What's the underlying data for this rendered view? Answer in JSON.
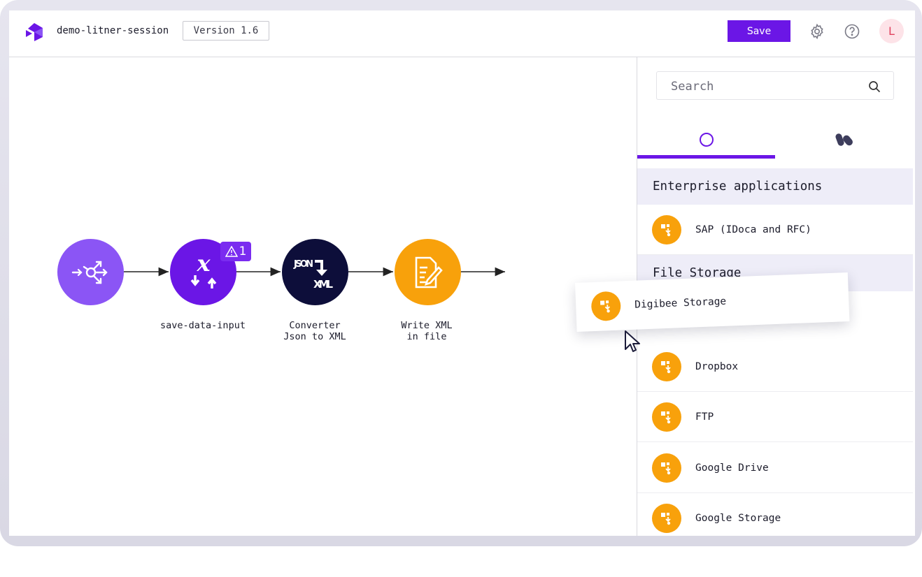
{
  "header": {
    "session_name": "demo-litner-session",
    "version": "Version 1.6",
    "save_label": "Save",
    "avatar_initial": "L",
    "icons": [
      "settings-icon",
      "help-icon"
    ]
  },
  "pipeline": {
    "nodes": [
      {
        "label": "",
        "icon": "trigger-icon",
        "color": "#8b55f5"
      },
      {
        "label": "save-data-input",
        "icon": "variable-icon",
        "color": "#6b16e6"
      },
      {
        "label": "Converter\nJson to XML",
        "icon": "json-to-xml-icon",
        "color": "#0d0e3a"
      },
      {
        "label": "Write XML\nin file",
        "icon": "file-write-icon",
        "color": "#f8a10b"
      }
    ],
    "warning_count": "1",
    "icon_text": {
      "json": "JSON",
      "xml": "XML"
    }
  },
  "sidebar": {
    "search_placeholder": "Search",
    "tabs": [
      {
        "icon": "circle-icon",
        "active": true
      },
      {
        "icon": "capsules-icon",
        "active": false
      }
    ],
    "sections": [
      {
        "title": "Enterprise applications",
        "items": [
          "SAP (IDoca and RFC)"
        ]
      },
      {
        "title": "File Storage",
        "items": [
          "Dropbox",
          "FTP",
          "Google Drive",
          "Google Storage"
        ]
      }
    ],
    "dragging_item": "Digibee Storage"
  },
  "colors": {
    "accent": "#6b16e6",
    "orange": "#f8a10b",
    "navy": "#0d0e3a",
    "section_bg": "#eeedf8"
  }
}
